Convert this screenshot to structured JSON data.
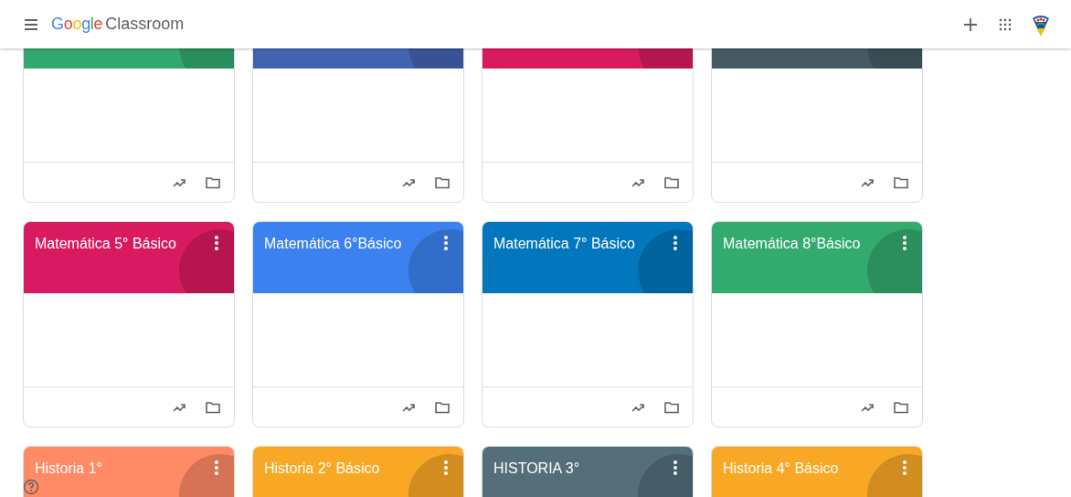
{
  "header": {
    "logo_word": "Google",
    "product": "Classroom"
  },
  "courses": [
    {
      "color": "#33a86e"
    },
    {
      "color": "#4264b0"
    },
    {
      "color": "#d81b60"
    },
    {
      "color": "#455a64"
    },
    {
      "title": "Matemática 5° Básico",
      "color": "#d81b60"
    },
    {
      "title": "Matemática 6°Básico",
      "color": "#3b82f0"
    },
    {
      "title": "Matemática 7° Básico",
      "color": "#0277bd"
    },
    {
      "title": "Matemática 8°Básico",
      "color": "#33ab6f"
    },
    {
      "title": "Historia 1°",
      "color": "#ff8a65"
    },
    {
      "title": "Historia 2° Básico",
      "color": "#f9a825"
    },
    {
      "title": "HISTORIA 3°",
      "color": "#546e7a"
    },
    {
      "title": "Historia 4° Básico",
      "color": "#f9a825"
    }
  ]
}
